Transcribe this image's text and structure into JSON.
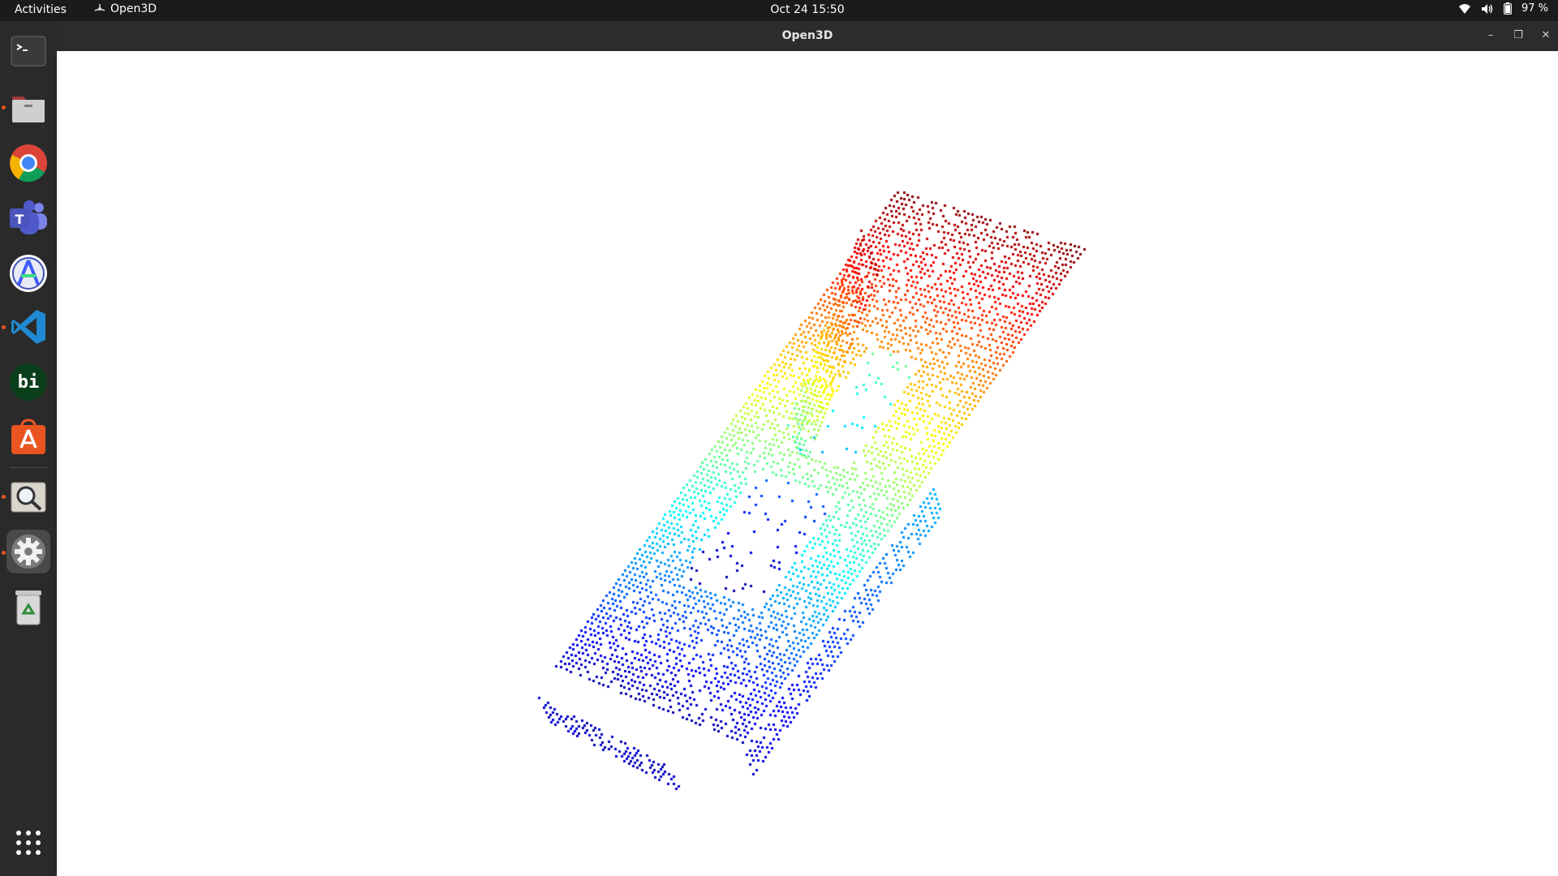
{
  "topbar": {
    "activities": "Activities",
    "app_name": "Open3D",
    "datetime": "Oct 24  15:50",
    "battery": "97 %",
    "icons": [
      "wifi-icon",
      "volume-icon",
      "battery-icon"
    ]
  },
  "dock": {
    "items": [
      {
        "name": "terminal",
        "icon": "terminal-icon",
        "running": false,
        "active": false
      },
      {
        "name": "files",
        "icon": "files-icon",
        "running": true,
        "active": false
      },
      {
        "name": "chrome",
        "icon": "chrome-icon",
        "running": false,
        "active": false
      },
      {
        "name": "teams",
        "icon": "teams-icon",
        "running": false,
        "active": false
      },
      {
        "name": "android-studio",
        "icon": "android-studio-icon",
        "running": false,
        "active": false
      },
      {
        "name": "vscode",
        "icon": "vscode-icon",
        "running": true,
        "active": false
      },
      {
        "name": "bi",
        "icon": "bi-icon",
        "label": "bi",
        "running": false,
        "active": false
      },
      {
        "name": "software-center",
        "icon": "software-center-icon",
        "running": false,
        "active": false
      },
      {
        "name": "image-viewer",
        "icon": "magnifier-icon",
        "running": true,
        "active": false
      },
      {
        "name": "open3d",
        "icon": "gear-icon",
        "running": true,
        "active": true
      },
      {
        "name": "trash",
        "icon": "trash-icon",
        "running": false,
        "active": false
      }
    ],
    "app_grid_icon": "app-grid-icon"
  },
  "window": {
    "title": "Open3D",
    "controls": [
      "minimize-icon",
      "maximize-icon",
      "close-icon"
    ]
  },
  "viewer": {
    "content": "voxelized point cloud",
    "colormap": "jet",
    "background": "#ffffff"
  },
  "colors": {
    "topbar": "#1b1b1b",
    "dock": "#2a2a2a",
    "titlebar": "#2c2c2c",
    "accent": "#e95420"
  }
}
